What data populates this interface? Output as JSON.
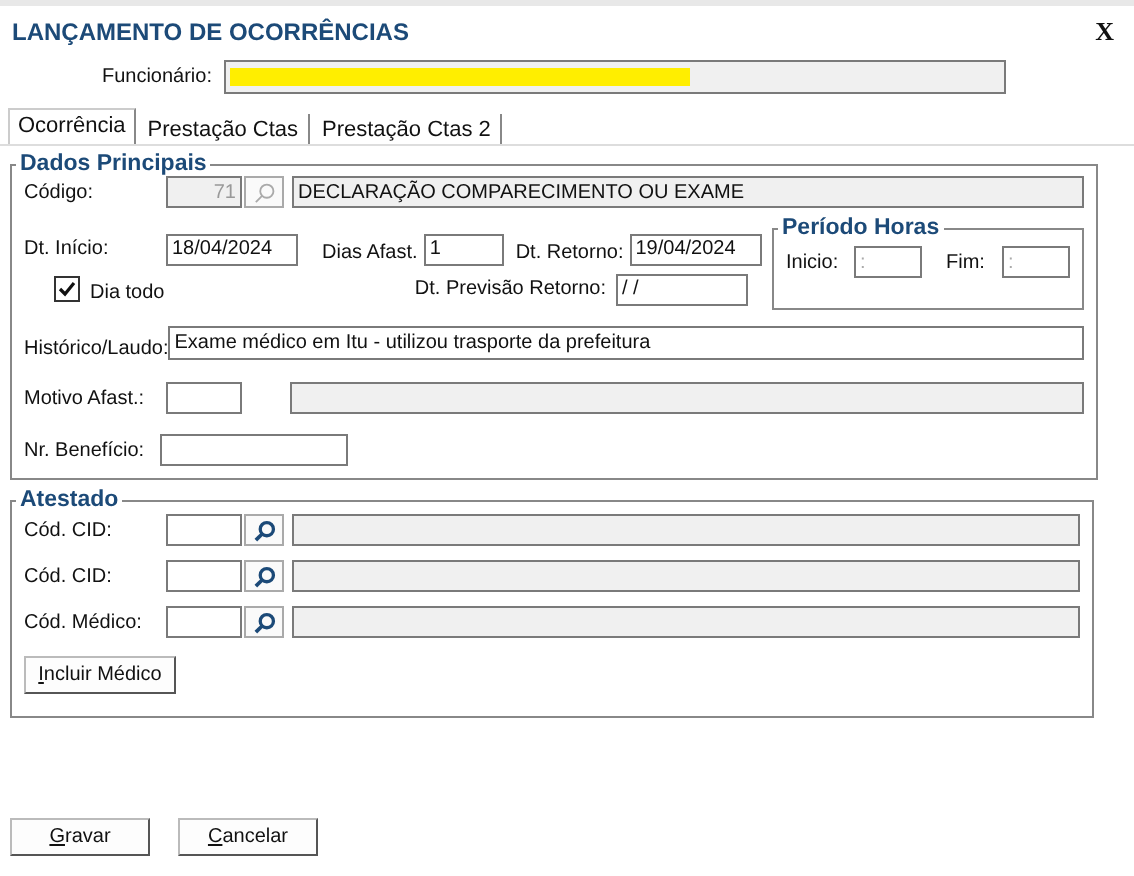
{
  "window": {
    "title": "LANÇAMENTO DE OCORRÊNCIAS",
    "close": "X"
  },
  "employee": {
    "label": "Funcionário:",
    "redacted": true
  },
  "tabs": [
    {
      "label": "Ocorrência",
      "selected": true
    },
    {
      "label": "Prestação Ctas",
      "selected": false
    },
    {
      "label": "Prestação Ctas 2",
      "selected": false
    }
  ],
  "main": {
    "title": "Dados Principais",
    "code": {
      "label": "Código:",
      "value": "71",
      "search_disabled": true,
      "description": "DECLARAÇÃO COMPARECIMENTO OU EXAME"
    },
    "start": {
      "label": "Dt. Início:",
      "value": "18/04/2024"
    },
    "days": {
      "label": "Dias Afast.",
      "value": "1"
    },
    "return": {
      "label": "Dt. Retorno:",
      "value": "19/04/2024"
    },
    "all_day": {
      "label": "Dia todo",
      "checked": true
    },
    "expected_return": {
      "label": "Dt. Previsão Retorno:",
      "value": " /  /"
    },
    "period": {
      "title": "Período Horas",
      "start": {
        "label": "Inicio:",
        "placeholder": ":"
      },
      "end": {
        "label": "Fim:",
        "placeholder": ":"
      }
    },
    "history": {
      "label": "Histórico/Laudo:",
      "value": "Exame médico em Itu - utilizou trasporte da prefeitura"
    },
    "reason": {
      "label": "Motivo Afast.:"
    },
    "benefit": {
      "label": "Nr. Benefício:"
    }
  },
  "certificate": {
    "title": "Atestado",
    "lookups": [
      {
        "label": "Cód. CID:",
        "search_disabled": false
      },
      {
        "label": "Cód. CID:",
        "search_disabled": false
      },
      {
        "label": "Cód. Médico:",
        "search_disabled": false
      }
    ],
    "button": "Incluir Médico"
  },
  "buttons": [
    "Gravar",
    "Cancelar"
  ]
}
